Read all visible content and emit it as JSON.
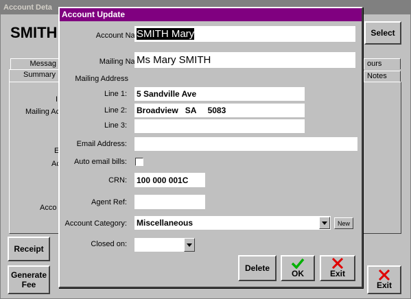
{
  "background": {
    "title": "Account Deta",
    "account_name": "SMITH",
    "select_label": "Select",
    "tabs": [
      {
        "label": "Messag"
      },
      {
        "label": "ours"
      },
      {
        "label": "Summary"
      },
      {
        "label": "Notes"
      }
    ],
    "labels": [
      "I",
      "Mailing Ac",
      "E",
      "Ac",
      "Acco"
    ],
    "receipt_label": "Receipt",
    "generate_fee_label": "Generate\nFee",
    "exit_label": "Exit"
  },
  "dialog": {
    "title": "Account Update",
    "account_name": {
      "label": "Account Name:",
      "value": "SMITH Mary"
    },
    "mailing_name": {
      "label": "Mailing Name:",
      "value": "Ms Mary SMITH"
    },
    "mailing_address_label": "Mailing Address",
    "line1": {
      "label": "Line 1:",
      "value": "5 Sandville Ave"
    },
    "line2": {
      "label": "Line 2:",
      "value": "Broadview   SA     5083"
    },
    "line3": {
      "label": "Line 3:",
      "value": ""
    },
    "email": {
      "label": "Email Address:",
      "value": ""
    },
    "auto_email": {
      "label": "Auto email bills:",
      "checked": false
    },
    "crn": {
      "label": "CRN:",
      "value": "100 000 001C"
    },
    "agent_ref": {
      "label": "Agent Ref:",
      "value": ""
    },
    "account_category": {
      "label": "Account Category:",
      "value": "Miscellaneous",
      "new_label": "New"
    },
    "closed_on": {
      "label": "Closed on:",
      "value": ""
    },
    "delete_label": "Delete",
    "ok_label": "OK",
    "exit_label": "Exit"
  },
  "colors": {
    "dialog_title_bg": "#800080",
    "ok_check": "#00b000",
    "exit_x": "#e00000"
  }
}
